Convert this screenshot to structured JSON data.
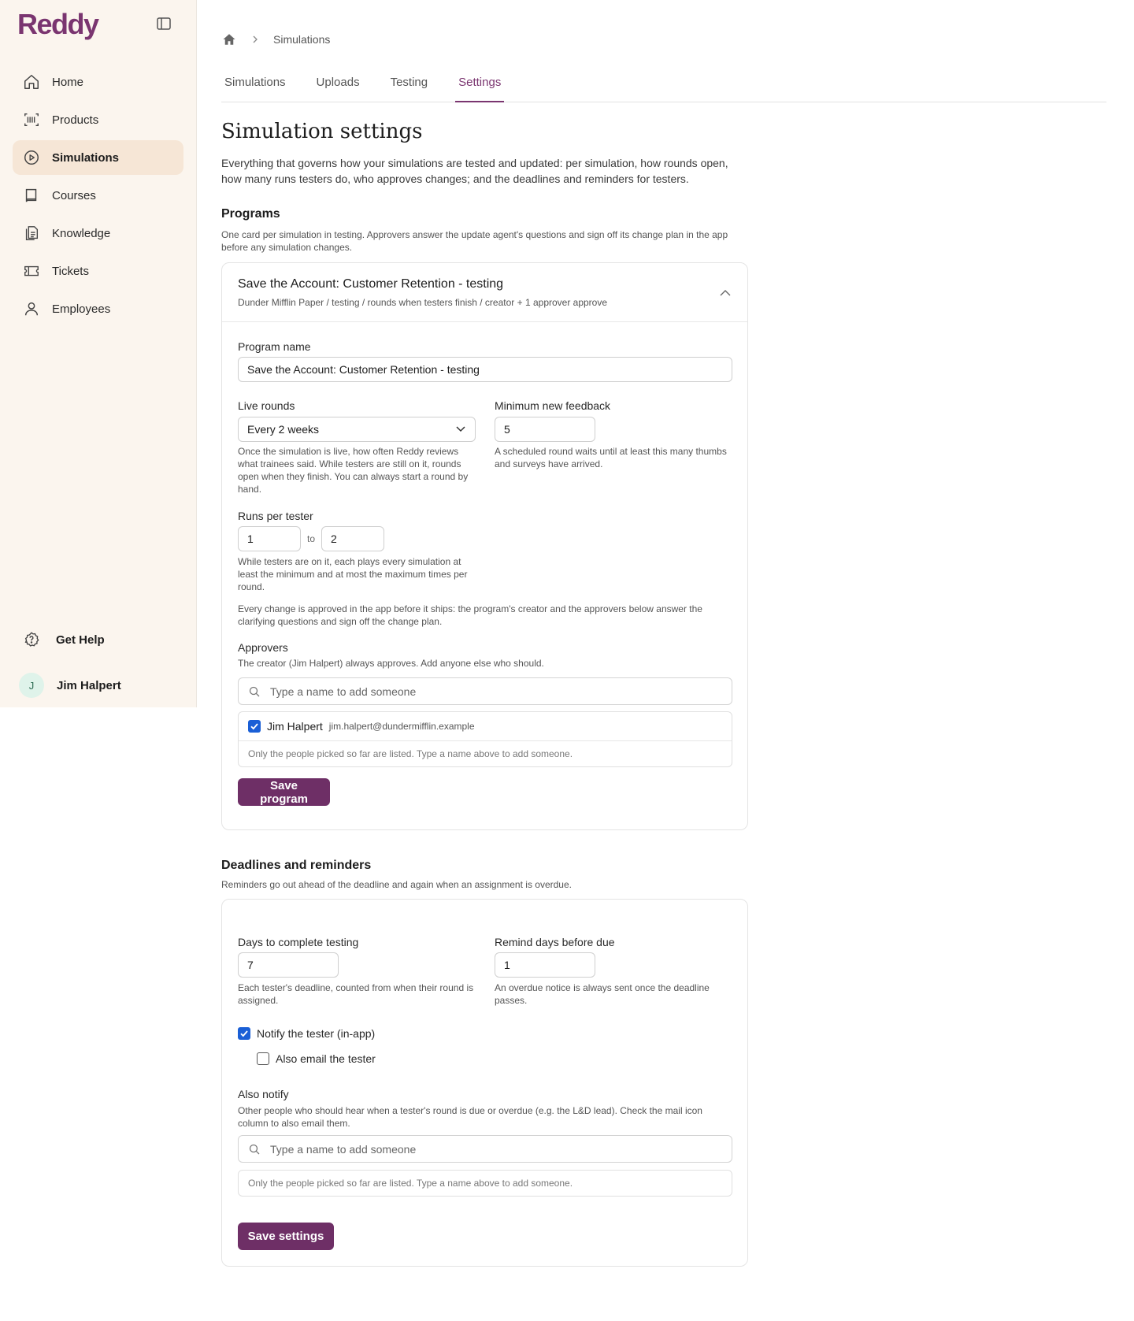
{
  "app": {
    "name": "Reddy"
  },
  "sidebar": {
    "items": [
      {
        "label": "Home",
        "icon": "home-icon"
      },
      {
        "label": "Products",
        "icon": "barcode-icon"
      },
      {
        "label": "Simulations",
        "icon": "play-circle-icon",
        "active": true
      },
      {
        "label": "Courses",
        "icon": "book-icon"
      },
      {
        "label": "Knowledge",
        "icon": "document-icon"
      },
      {
        "label": "Tickets",
        "icon": "ticket-icon"
      },
      {
        "label": "Employees",
        "icon": "user-icon"
      }
    ],
    "help_label": "Get Help",
    "user": {
      "name": "Jim Halpert",
      "initial": "J"
    }
  },
  "breadcrumb": {
    "current": "Simulations"
  },
  "tabs": [
    "Simulations",
    "Uploads",
    "Testing",
    "Settings"
  ],
  "active_tab": "Settings",
  "page": {
    "title": "Simulation settings",
    "description": "Everything that governs how your simulations are tested and updated: per simulation, how rounds open, how many runs testers do, who approves changes; and the deadlines and reminders for testers."
  },
  "programs": {
    "title": "Programs",
    "description": "One card per simulation in testing. Approvers answer the update agent's questions and sign off its change plan in the app before any simulation changes.",
    "card": {
      "title": "Save the Account: Customer Retention - testing",
      "subtitle": "Dunder Mifflin Paper / testing / rounds when testers finish / creator + 1 approver approve",
      "program_name_label": "Program name",
      "program_name_value": "Save the Account: Customer Retention - testing",
      "live_rounds_label": "Live rounds",
      "live_rounds_value": "Every 2 weeks",
      "live_rounds_help": "Once the simulation is live, how often Reddy reviews what trainees said. While testers are still on it, rounds open when they finish. You can always start a round by hand.",
      "min_feedback_label": "Minimum new feedback",
      "min_feedback_value": "5",
      "min_feedback_help": "A scheduled round waits until at least this many thumbs and surveys have arrived.",
      "runs_label": "Runs per tester",
      "runs_min": "1",
      "runs_to": "to",
      "runs_max": "2",
      "runs_help": "While testers are on it, each plays every simulation at least the minimum and at most the maximum times per round.",
      "approval_note": "Every change is approved in the app before it ships: the program's creator and the approvers below answer the clarifying questions and sign off the change plan.",
      "approvers_label": "Approvers",
      "approvers_help": "The creator (Jim Halpert) always approves. Add anyone else who should.",
      "approvers_placeholder": "Type a name to add someone",
      "approvers": [
        {
          "name": "Jim Halpert",
          "email": "jim.halpert@dundermifflin.example",
          "checked": true
        }
      ],
      "approvers_note": "Only the people picked so far are listed. Type a name above to add someone.",
      "save_label": "Save program"
    }
  },
  "deadlines": {
    "title": "Deadlines and reminders",
    "description": "Reminders go out ahead of the deadline and again when an assignment is overdue.",
    "days_label": "Days to complete testing",
    "days_value": "7",
    "days_help": "Each tester's deadline, counted from when their round is assigned.",
    "remind_label": "Remind days before due",
    "remind_value": "1",
    "remind_help": "An overdue notice is always sent once the deadline passes.",
    "notify_tester_label": "Notify the tester (in-app)",
    "notify_tester_checked": true,
    "email_tester_label": "Also email the tester",
    "email_tester_checked": false,
    "also_notify_label": "Also notify",
    "also_notify_help": "Other people who should hear when a tester's round is due or overdue (e.g. the L&D lead). Check the mail icon column to also email them.",
    "also_notify_placeholder": "Type a name to add someone",
    "also_notify_note": "Only the people picked so far are listed. Type a name above to add someone.",
    "save_label": "Save settings"
  },
  "colors": {
    "accent": "#7a3570",
    "button": "#6e2f66",
    "sidebar_bg": "#fbf5ee",
    "active_nav": "#f6e6d6",
    "checkbox": "#1a5fd6"
  }
}
